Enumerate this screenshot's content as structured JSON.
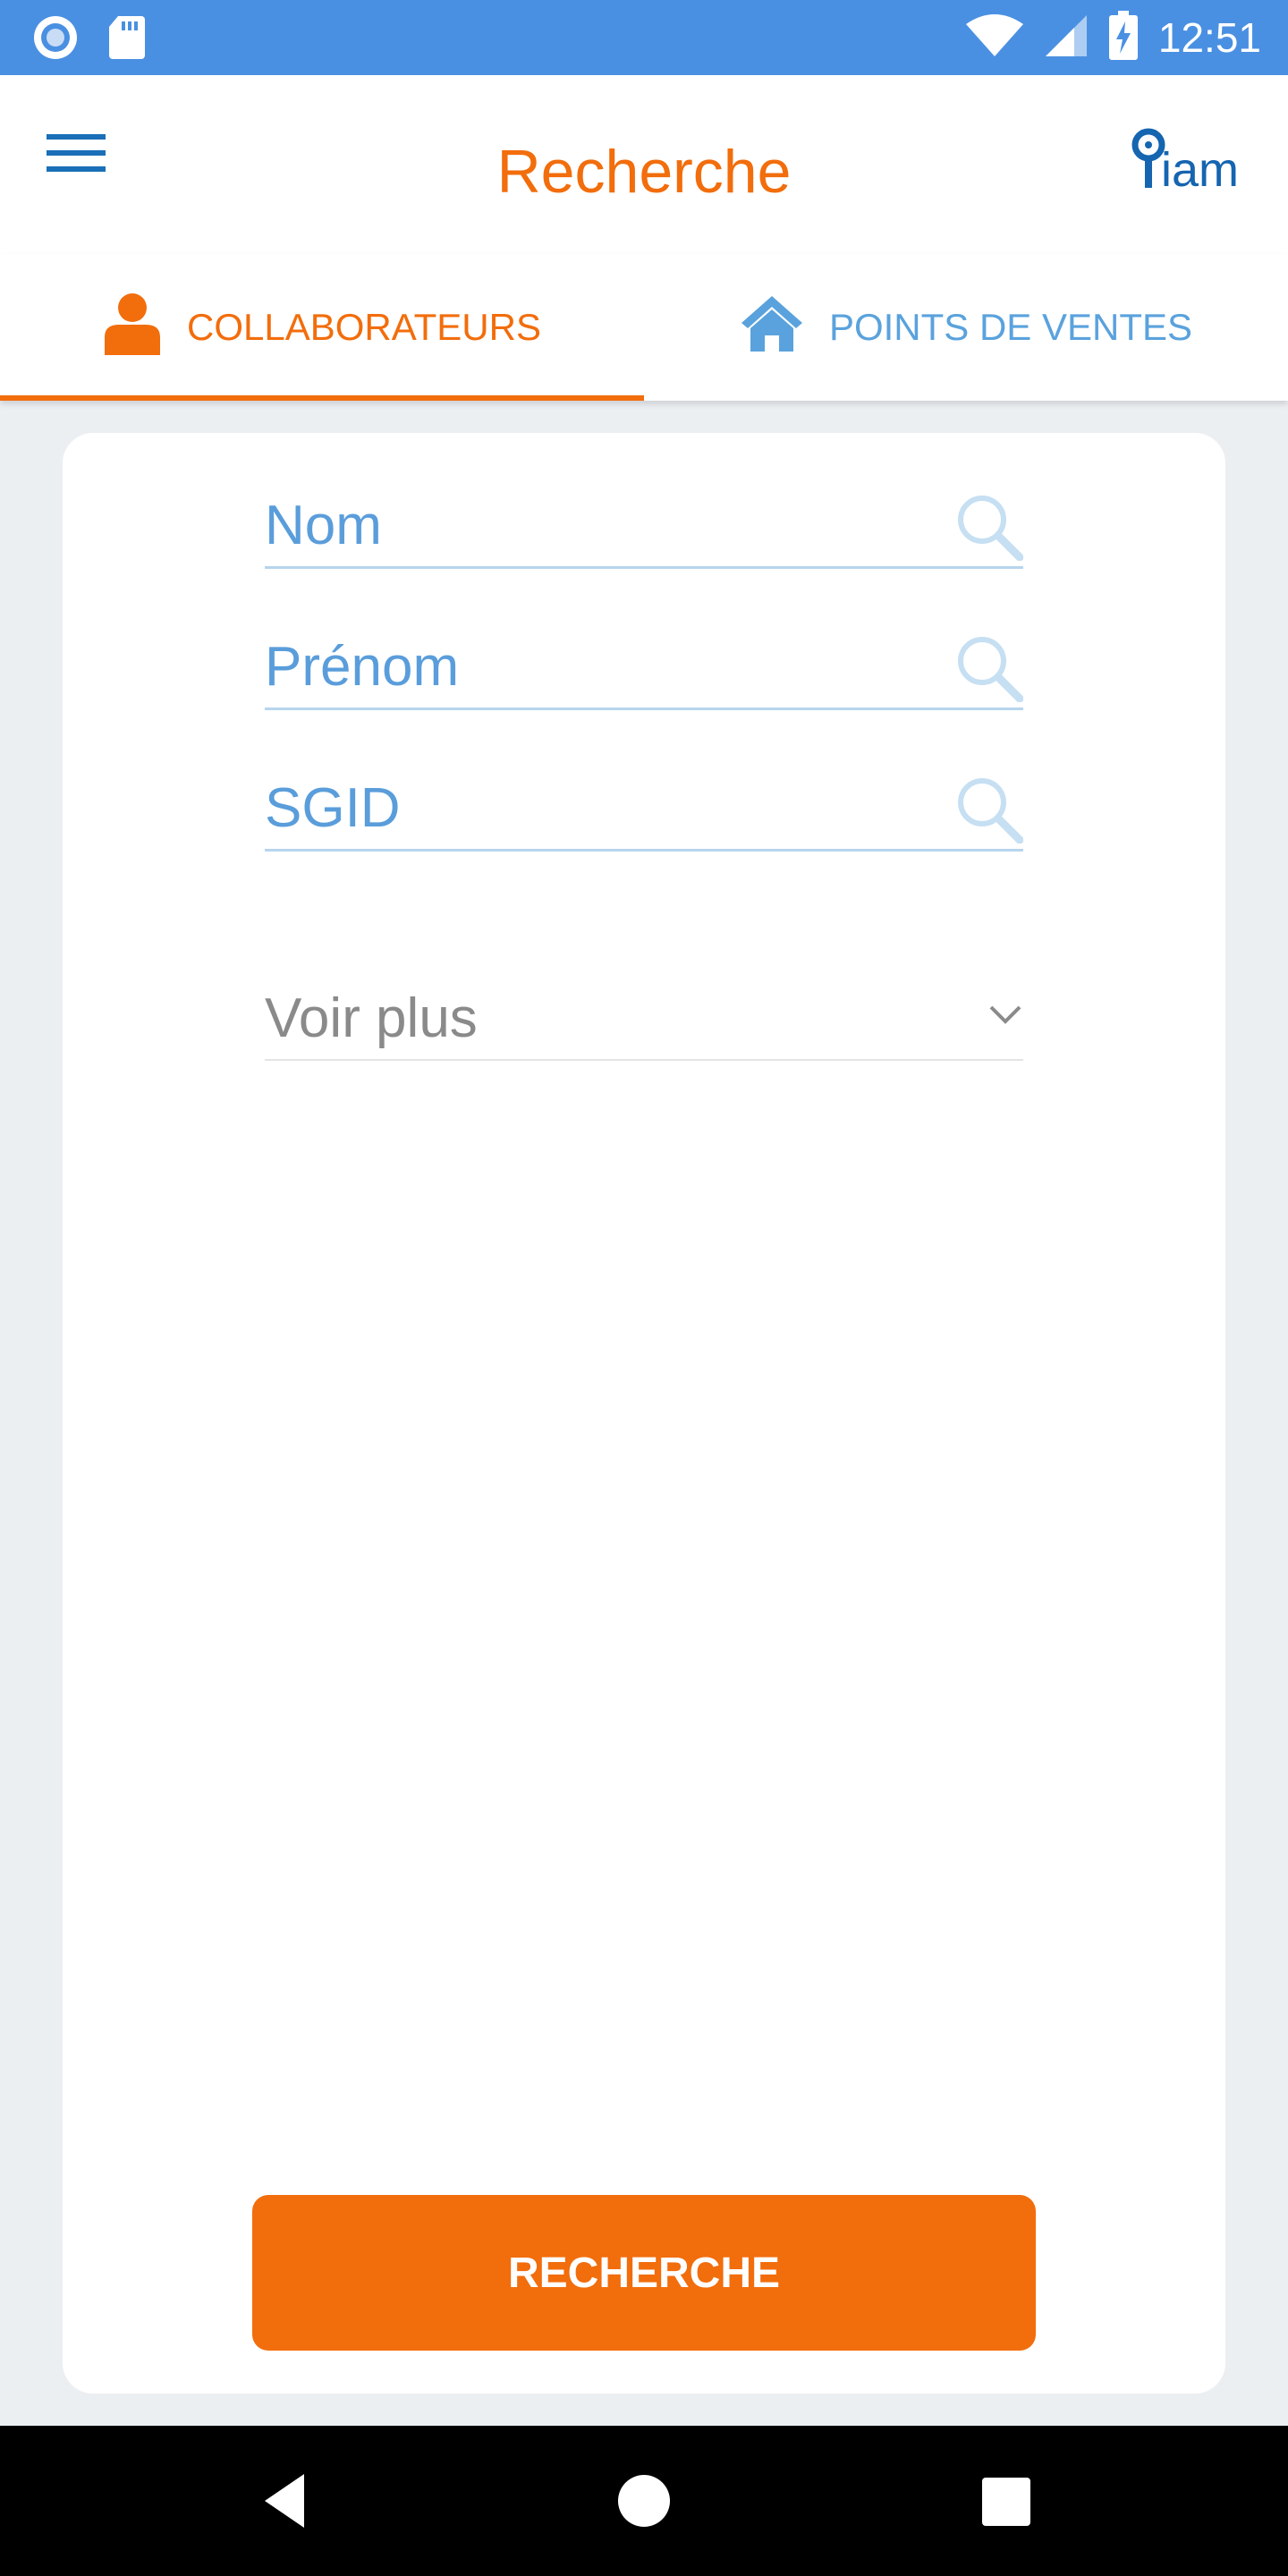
{
  "status_bar": {
    "time": "12:51",
    "icons": [
      "notification-circle-icon",
      "sd-card-icon",
      "wifi-icon",
      "cell-signal-icon",
      "battery-charging-icon"
    ],
    "background": "#4a90e2"
  },
  "header": {
    "title": "Recherche",
    "menu_icon": "hamburger-menu-icon",
    "logo_icon": "iam-logo",
    "logo_text": "iam"
  },
  "tabs": [
    {
      "label": "COLLABORATEURS",
      "icon": "person-icon",
      "active": true
    },
    {
      "label": "POINTS DE VENTES",
      "icon": "home-icon",
      "active": false
    }
  ],
  "form": {
    "fields": [
      {
        "placeholder": "Nom",
        "icon": "search-icon"
      },
      {
        "placeholder": "Prénom",
        "icon": "search-icon"
      },
      {
        "placeholder": "SGID",
        "icon": "search-icon"
      }
    ],
    "more": {
      "label": "Voir plus",
      "icon": "chevron-down-icon"
    },
    "submit_label": "RECHERCHE"
  },
  "nav_bar": {
    "buttons": [
      "back-triangle-icon",
      "home-circle-icon",
      "recents-square-icon"
    ]
  },
  "colors": {
    "accent": "#f26d0c",
    "link_blue": "#5aa2dd",
    "field_text": "#5a9ddb",
    "background": "#eceff2"
  }
}
